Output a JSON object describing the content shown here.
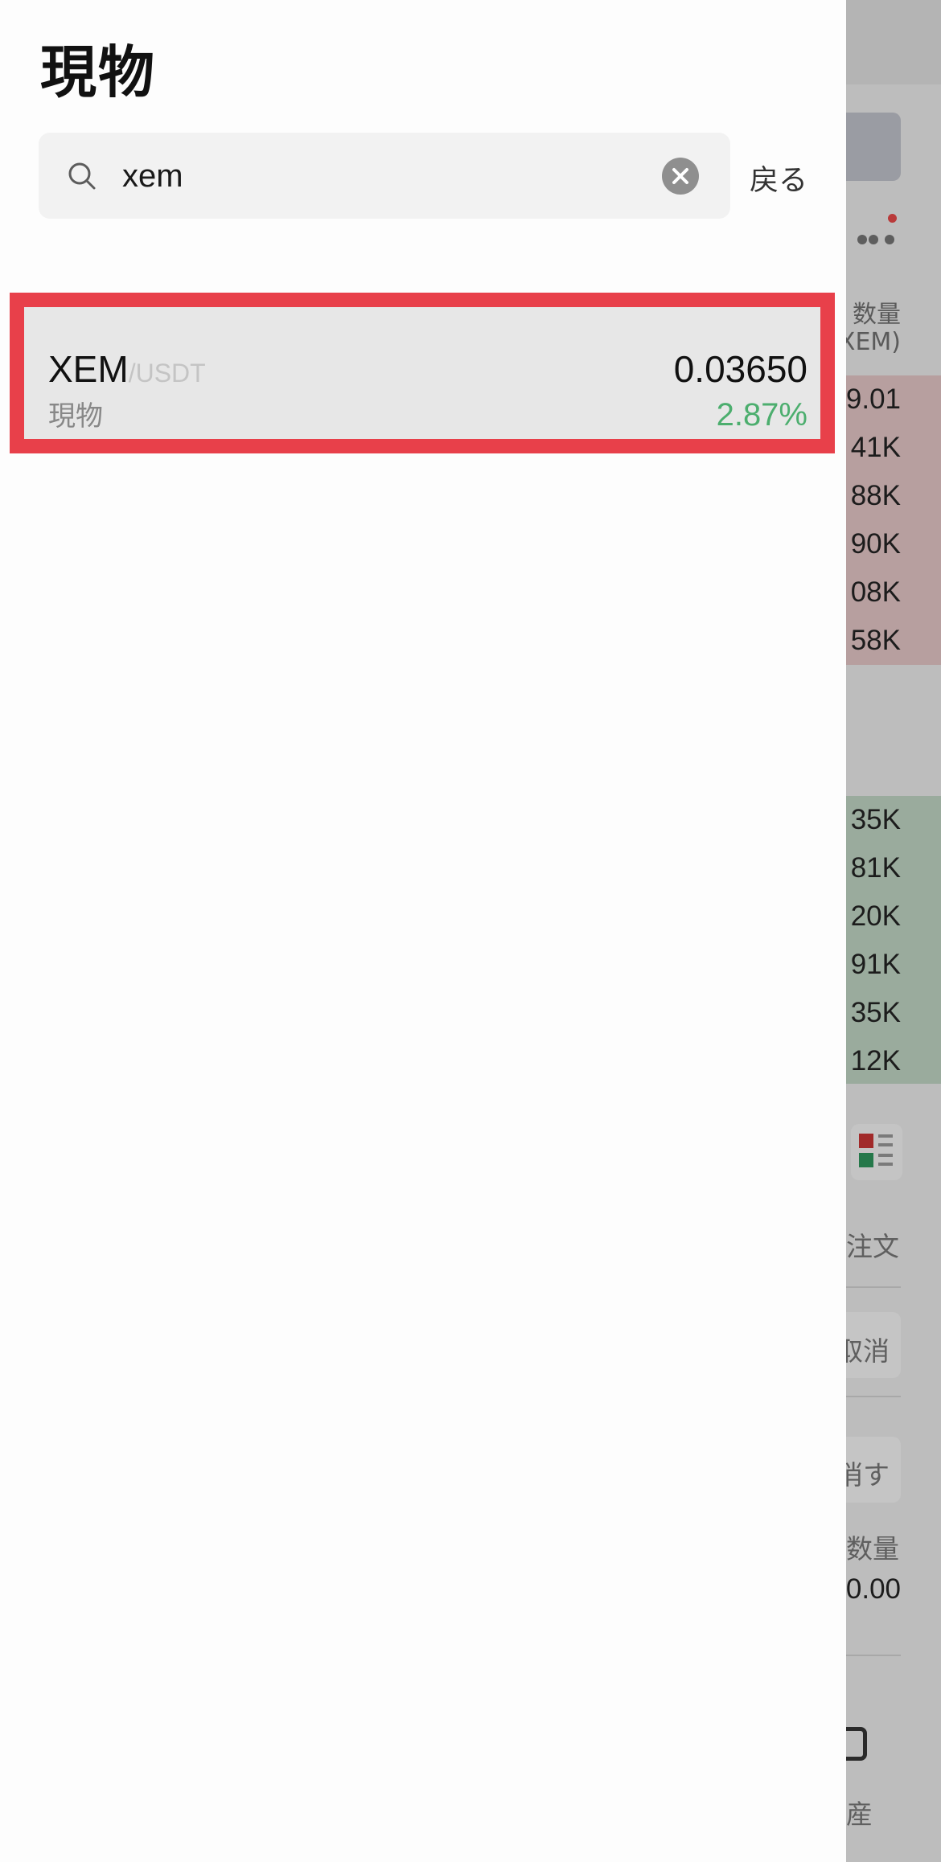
{
  "header": {
    "title": "現物"
  },
  "search": {
    "value": "xem",
    "back_label": "戻る"
  },
  "results": [
    {
      "base": "XEM",
      "quote": "/USDT",
      "market": "現物",
      "price": "0.03650",
      "change": "2.87%"
    }
  ],
  "background": {
    "qty_header": "数量",
    "unit_header": "XEM)",
    "asks": [
      "9.01",
      "41K",
      "88K",
      "90K",
      "08K",
      "58K"
    ],
    "bids": [
      "35K",
      "81K",
      "20K",
      "91K",
      "35K",
      "12K"
    ],
    "order_label": "注文",
    "cancel_label": "取消",
    "cancel_all_label": "消す",
    "qty_label": "数量",
    "qty_value": "0.00",
    "assets_label": "産"
  },
  "colors": {
    "highlight_border": "#e8404a",
    "positive": "#4cae6e"
  }
}
